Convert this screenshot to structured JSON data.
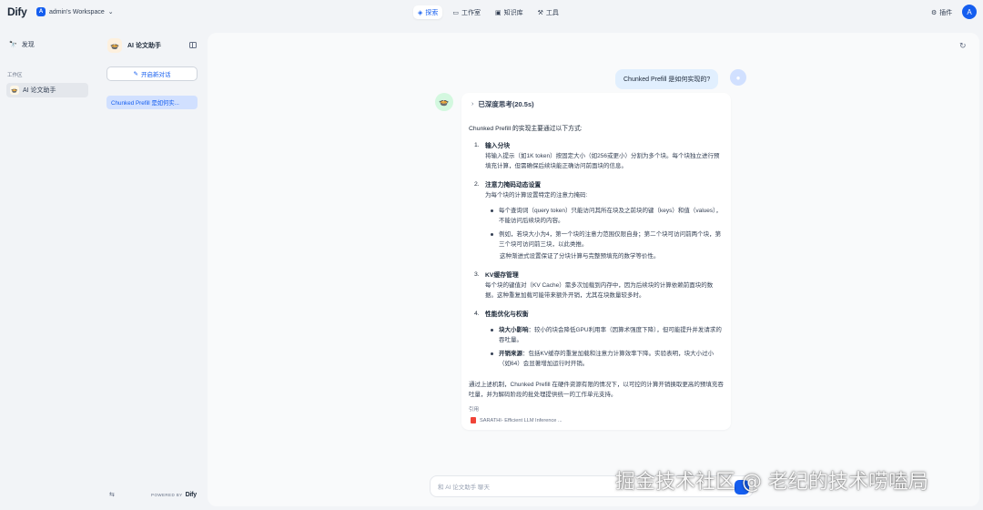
{
  "topbar": {
    "logo": "Dify",
    "workspace_badge": "A",
    "workspace_name": "admin's Workspace",
    "nav": [
      {
        "label": "探索",
        "icon": "compass-icon",
        "active": true
      },
      {
        "label": "工作室",
        "icon": "studio-icon",
        "active": false
      },
      {
        "label": "知识库",
        "icon": "knowledge-icon",
        "active": false
      },
      {
        "label": "工具",
        "icon": "tools-icon",
        "active": false
      }
    ],
    "plugins_label": "插件",
    "user_initial": "A"
  },
  "leftnav": {
    "discover_label": "发现",
    "workspace_label": "工作区",
    "app_label": "AI 论文助手"
  },
  "convpanel": {
    "app_title": "AI 论文助手",
    "new_chat_label": "开启新对话",
    "conversations": [
      "Chunked Prefill 是如何实..."
    ],
    "powered_by": "POWERED BY",
    "powered_brand": "Dify"
  },
  "chat": {
    "user_message": "Chunked Prefill 是如何实现的?",
    "think_label": "已深度思考(20.5s)",
    "intro": "Chunked Prefill 的实现主要通过以下方式:",
    "sections": [
      {
        "num": "1.",
        "title": "输入分块",
        "text": "将输入提示（如1K token）按固定大小（如256或更小）分割为多个块。每个块独立进行预填充计算，但需确保后续块能正确访问前面块的信息。"
      },
      {
        "num": "2.",
        "title": "注意力掩码动态设置",
        "text": "为每个块的计算设置特定的注意力掩码:",
        "bullets": [
          "每个查询词（query token）只能访问其所在块及之前块的键（keys）和值（values），不能访问后续块的内容。",
          "例如，若块大小为4，第一个块的注意力范围仅限自身；第二个块可访问前两个块，第三个块可访问前三块，以此类推。"
        ],
        "after": "这种渐进式设置保证了分块计算与完整预填充的数学等价性。"
      },
      {
        "num": "3.",
        "title": "KV缓存管理",
        "text": "每个块的键值对（KV Cache）需多次加载到内存中，因为后续块的计算依赖前面块的数据。这种重复加载可能带来额外开销，尤其在块数量较多时。"
      },
      {
        "num": "4.",
        "title": "性能优化与权衡",
        "bullets_bold": [
          {
            "bold": "块大小影响",
            "text": "：较小的块会降低GPU利用率（因算术强度下降），但可能提升并发请求的吞吐量。"
          },
          {
            "bold": "开销来源",
            "text": "：包括KV缓存的重复加载和注意力计算效率下降。实验表明，块大小过小（如64）会显著增加运行时开销。"
          }
        ]
      }
    ],
    "summary": "通过上述机制，Chunked Prefill 在硬件资源有限的情况下，以可控的计算开销换取更高的预填充吞吐量，并为解码阶段的批处理提供统一的工作单元支持。",
    "citation_label": "引用",
    "citation": "SARATHI- Efficient LLM Inference ...",
    "input_placeholder": "和 AI 论文助手 聊天"
  },
  "watermark": "掘金技术社区 @ 老纪的技术唠嗑局",
  "colors": {
    "accent": "#155eef",
    "bg": "#f2f4f7"
  }
}
